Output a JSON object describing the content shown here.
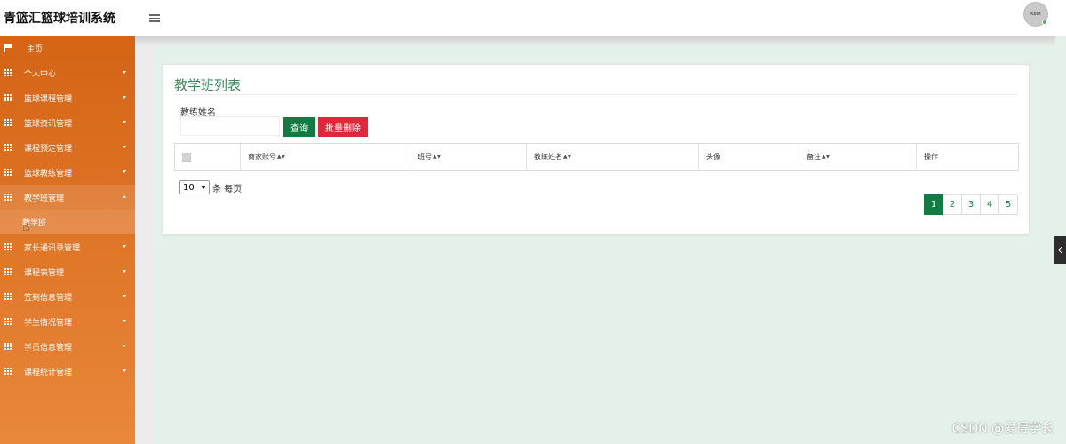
{
  "app": {
    "title": "青篮汇篮球培训系统",
    "avatar_text": "Kb8t"
  },
  "sidebar": {
    "home": "主页",
    "items": [
      {
        "label": "个人中心",
        "expanded": false
      },
      {
        "label": "篮球课程管理",
        "expanded": false
      },
      {
        "label": "篮球资讯管理",
        "expanded": false
      },
      {
        "label": "课程预定管理",
        "expanded": false
      },
      {
        "label": "篮球教练管理",
        "expanded": false
      },
      {
        "label": "教学班管理",
        "expanded": true,
        "sub": "教学班"
      },
      {
        "label": "家长通讯录管理",
        "expanded": false
      },
      {
        "label": "课程表管理",
        "expanded": false
      },
      {
        "label": "签到信息管理",
        "expanded": false
      },
      {
        "label": "学生情况管理",
        "expanded": false
      },
      {
        "label": "学员信息管理",
        "expanded": false
      },
      {
        "label": "课程统计管理",
        "expanded": false
      }
    ]
  },
  "main": {
    "title": "教学班列表",
    "search_label": "教练姓名",
    "search_value": "",
    "query_button": "查询",
    "batch_delete_button": "批量删除",
    "columns": [
      "商家账号",
      "班号",
      "教练姓名",
      "头像",
      "备注",
      "操作"
    ],
    "page_size": "10",
    "page_size_suffix": "条 每页",
    "pages": [
      "1",
      "2",
      "3",
      "4",
      "5"
    ],
    "current_page": "1"
  },
  "watermark": "CSDN @爱得学长",
  "colors": {
    "sidebar_top": "#d56415",
    "sidebar_bottom": "#e9873a",
    "accent": "#127a43",
    "danger": "#e0283a",
    "title": "#3c8a59"
  }
}
